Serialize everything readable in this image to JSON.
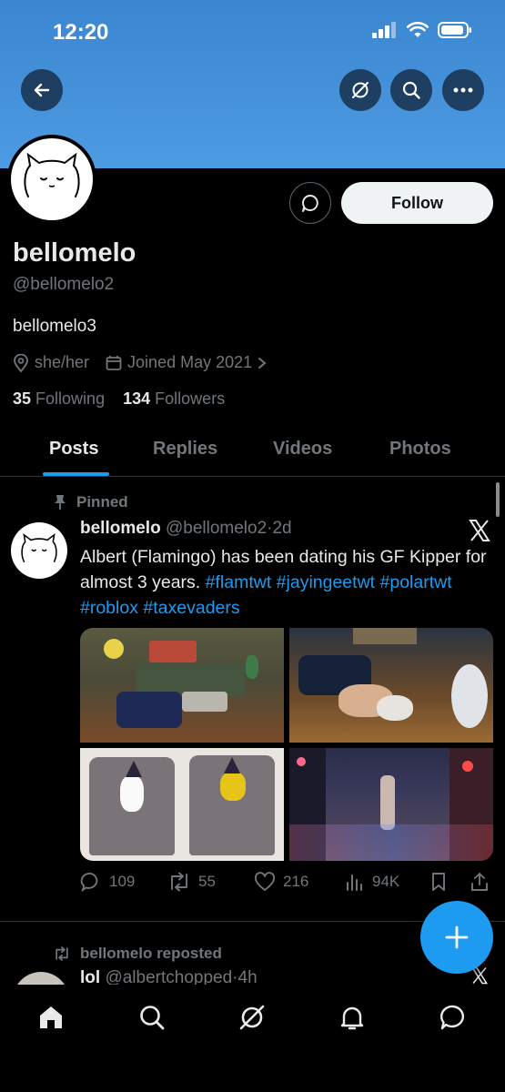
{
  "status_bar": {
    "time": "12:20"
  },
  "header": {
    "back_icon": "arrow-left-icon",
    "grok_icon": "grok-icon",
    "search_icon": "search-icon",
    "more_icon": "more-icon"
  },
  "profile": {
    "display_name": "bellomelo",
    "handle": "@bellomelo2",
    "bio": "bellomelo3",
    "pronouns": "she/her",
    "joined": "Joined May 2021",
    "following_count": "35",
    "following_label": "Following",
    "followers_count": "134",
    "followers_label": "Followers",
    "follow_label": "Follow"
  },
  "tabs": [
    "Posts",
    "Replies",
    "Videos",
    "Photos"
  ],
  "pinned_post": {
    "pinned_label": "Pinned",
    "author_name": "bellomelo",
    "author_handle": "@bellomelo2",
    "time": "2d",
    "text": "Albert (Flamingo) has been dating his GF Kipper for almost 3 years.",
    "hashtags": [
      "#flamtwt",
      "#jayingeetwt",
      "#polartwt",
      "#roblox",
      "#taxevaders"
    ],
    "replies": "109",
    "reposts": "55",
    "likes": "216",
    "views": "94K"
  },
  "next_post": {
    "repost_label": "bellomelo reposted",
    "author_name": "lol",
    "author_handle": "@albertchopped",
    "time": "4h"
  },
  "colors": {
    "accent": "#1d9bf0",
    "banner": "#4d9be3",
    "background": "#000000"
  }
}
